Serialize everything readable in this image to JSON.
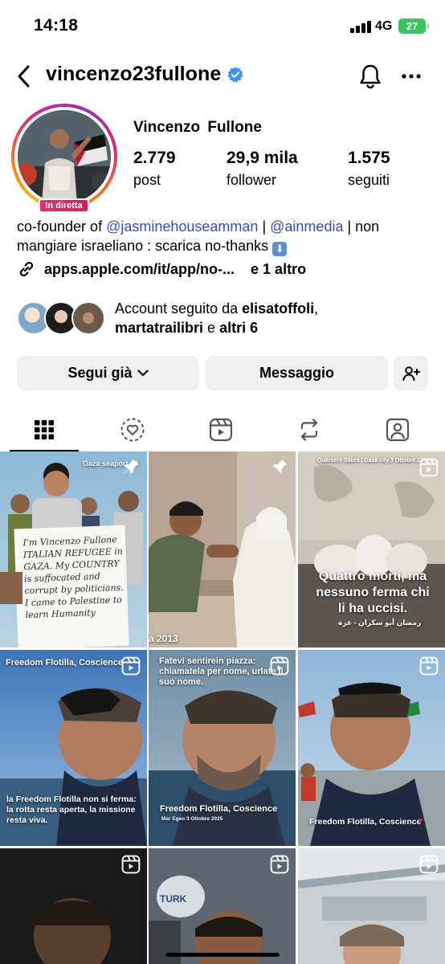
{
  "status_bar": {
    "time": "14:18",
    "network": "4G",
    "battery": "27"
  },
  "header": {
    "username": "vincenzo23fullone",
    "verified": true
  },
  "profile": {
    "full_name": "Vincenzo  Fullone",
    "live_badge": "In diretta",
    "stats": {
      "posts": {
        "value": "2.779",
        "label": "post"
      },
      "followers": {
        "value": "29,9 mila",
        "label": "follower"
      },
      "following": {
        "value": "1.575",
        "label": "seguiti"
      }
    },
    "bio": {
      "prefix": "co-founder of ",
      "mention1": "@jasminehouseamman",
      "sep": " | ",
      "mention2": "@ainmedia",
      "suffix": " | non mangiare israeliano : scarica no-thanks "
    },
    "link": {
      "text": "apps.apple.com/it/app/no-...",
      "more": "e 1 altro"
    },
    "followed_by": {
      "prefix": "Account seguito da ",
      "user1": "elisatoffoli",
      "comma": ",",
      "user2": "martatrailibri",
      "and": " e ",
      "others": "altri 6"
    }
  },
  "actions": {
    "following_label": "Segui già",
    "message_label": "Messaggio"
  },
  "tabs": [
    "grid",
    "highlights",
    "reels",
    "reposts",
    "tagged"
  ],
  "grid": {
    "tile1_caption": "Gaza seaport 20",
    "tile1_sign": "I'm Vincenzo Fullone ITALIAN REFUGEE in GAZA. My COUNTRY is suffocated and corrupt by politicians. I came to Palestine to learn Humanity",
    "tile2_caption": "a 2013",
    "tile3_top": "Quartiere Sabra , Gaza city 3 Ottobre 2",
    "tile3_caption": "Quattro morti, ma nessuno ferma chi li ha uccisi.",
    "tile3_arabic": "رمضان أبو سكران - غزة",
    "tile4_top": "Freedom Flotilla, Coscience",
    "tile4_caption": "la Freedom Flotilla non si ferma: la rotta resta aperta, la missione resta viva.",
    "tile5_top": "Fatevi sentirein piazza: chiamatela per nome, urlate il suo nome.",
    "tile5_caption": "Freedom Flotilla, Coscience",
    "tile5_sub": "Mar Egeo 3 Ottobre 2025",
    "tile6_caption": "Freedom Flotilla, Coscience",
    "tile8_text": "TURK"
  },
  "colors": {
    "accent": "#3b4bbf",
    "live": "#e1306c",
    "battery": "#34c759",
    "verified": "#3897f0"
  }
}
